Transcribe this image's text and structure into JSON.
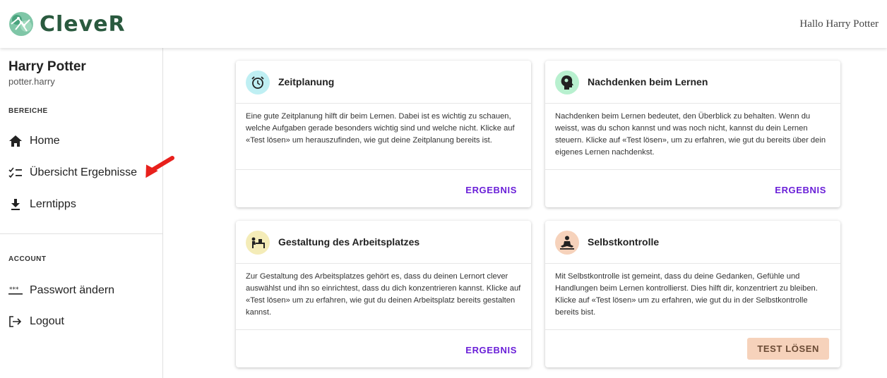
{
  "header": {
    "logo_text": "CleveR",
    "greeting": "Hallo Harry Potter"
  },
  "sidebar": {
    "user_name": "Harry Potter",
    "user_login": "potter.harry",
    "section_areas": "BEREICHE",
    "items": [
      {
        "label": "Home",
        "icon": "home-icon"
      },
      {
        "label": "Übersicht Ergebnisse",
        "icon": "checklist-icon"
      },
      {
        "label": "Lerntipps",
        "icon": "download-icon"
      }
    ],
    "section_account": "ACCOUNT",
    "account_items": [
      {
        "label": "Passwort ändern",
        "icon": "password-icon"
      },
      {
        "label": "Logout",
        "icon": "logout-icon"
      }
    ]
  },
  "cards": [
    {
      "title": "Zeitplanung",
      "icon": "alarm-clock-icon",
      "icon_bg": "#bfeff3",
      "text": "Eine gute Zeitplanung hilft dir beim Lernen. Dabei ist es wichtig zu schauen, welche Aufgaben gerade besonders wichtig sind und welche nicht. Klicke auf «Test lösen» um herauszufinden, wie gut deine Zeitplanung bereits ist.",
      "button": "ERGEBNIS"
    },
    {
      "title": "Nachdenken beim Lernen",
      "icon": "thinking-head-icon",
      "icon_bg": "#b8f0cf",
      "text": "Nachdenken beim Lernen bedeutet, den Überblick zu behalten. Wenn du weisst, was du schon kannst und was noch nicht, kannst du dein Lernen steuern. Klicke auf «Test lösen», um zu erfahren, wie gut du bereits über dein eigenes Lernen nachdenkst.",
      "button": "ERGEBNIS"
    },
    {
      "title": "Gestaltung des Arbeitsplatzes",
      "icon": "desk-icon",
      "icon_bg": "#f4ecb8",
      "text": "Zur Gestaltung des Arbeitsplatzes gehört es, dass du deinen Lernort clever auswählst und ihn so einrichtest, dass du dich konzentrieren kannst. Klicke auf «Test lösen» um zu erfahren, wie gut du deinen Arbeitsplatz bereits gestalten kannst.",
      "button": "ERGEBNIS"
    },
    {
      "title": "Selbstkontrolle",
      "icon": "meditation-icon",
      "icon_bg": "#f6d2bb",
      "text": "Mit Selbstkontrolle ist gemeint, dass du deine Gedanken, Gefühle und Handlungen beim Lernen kontrollierst. Dies hilft dir, konzentriert zu bleiben. Klicke auf «Test lösen» um zu erfahren, wie gut du in der Selbstkontrolle bereits bist.",
      "button": "TEST LÖSEN"
    }
  ]
}
